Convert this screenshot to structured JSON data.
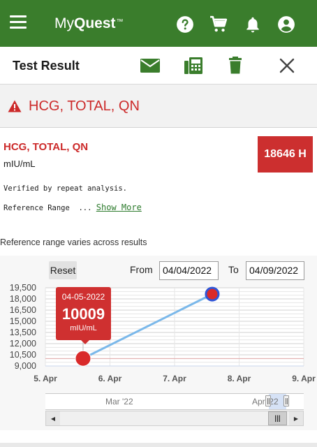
{
  "app": {
    "brand_prefix": "My",
    "brand_name": "Quest",
    "brand_tm": "™"
  },
  "colors": {
    "brand_green": "#3a7d2c",
    "alert_red": "#cc2a2a",
    "line_blue": "#7ab8ea",
    "marker_blue": "#2f55d6",
    "marker_red": "#d92a2a"
  },
  "icons": {
    "menu": "hamburger-menu-icon",
    "help": "help-icon",
    "cart": "cart-icon",
    "notifications": "bell-icon",
    "account": "account-icon",
    "email": "envelope-icon",
    "fax": "fax-icon",
    "delete": "trash-icon",
    "close": "close-icon",
    "warning": "warning-triangle-icon"
  },
  "header": {
    "title": "Test Result"
  },
  "banner": {
    "title": "HCG, TOTAL, QN"
  },
  "result": {
    "name": "HCG, TOTAL, QN",
    "units": "mIU/mL",
    "value": "18646 H",
    "comment": "Verified by repeat analysis.",
    "reference_label": "Reference Range",
    "reference_ellipsis": "...",
    "show_more": "Show More",
    "range_note": "Reference range varies across results"
  },
  "chart_controls": {
    "reset_label": "Reset",
    "from_label": "From",
    "from_date": "04/04/2022",
    "to_label": "To",
    "to_date": "04/09/2022"
  },
  "chart_data": {
    "type": "line",
    "x": [
      "2022-04-05T14:00",
      "2022-04-07T14:00"
    ],
    "y": [
      10009,
      18646
    ],
    "series": [
      {
        "name": "",
        "x": [
          "2022-04-05T14:00",
          "2022-04-07T14:00"
        ],
        "values": [
          10009,
          18646
        ]
      }
    ],
    "yticks": [
      "19,500",
      "18,000",
      "16,500",
      "15,000",
      "13,500",
      "12,000",
      "10,500",
      "9,000"
    ],
    "ytick_values": [
      19500,
      18000,
      16500,
      15000,
      13500,
      12000,
      10500,
      9000
    ],
    "xticks": [
      "5. Apr",
      "6. Apr",
      "7. Apr",
      "8. Apr",
      "9. Apr"
    ],
    "xtick_dates": [
      "2022-04-05",
      "2022-04-06",
      "2022-04-07",
      "2022-04-08",
      "2022-04-09"
    ],
    "ylim": [
      9000,
      19500
    ],
    "xlim": [
      "2022-04-05",
      "2022-04-09"
    ],
    "grid": true,
    "reference_line": 10000,
    "title": "",
    "xlabel": "",
    "ylabel": "",
    "tooltip": {
      "date": "04-05-2022",
      "value": "10009",
      "units": "mIU/mL"
    }
  },
  "navigator": {
    "left_label": "Mar '22",
    "right_label": "Apr '22"
  }
}
